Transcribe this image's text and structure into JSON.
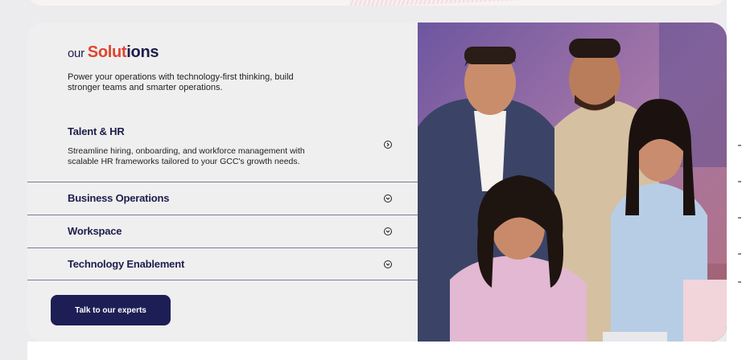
{
  "solutions": {
    "heading_prefix": "our",
    "heading_accent": "Solut",
    "heading_rest": "ions",
    "intro": "Power your operations with technology-first thinking, build stronger teams and smarter operations.",
    "items": [
      {
        "title": "Talent & HR",
        "description": "Streamline hiring, onboarding, and workforce management with scalable HR frameworks tailored to your GCC's growth needs.",
        "expanded": true,
        "icon": "chevron-right-circle-icon"
      },
      {
        "title": "Business Operations",
        "expanded": false,
        "icon": "chevron-down-circle-icon"
      },
      {
        "title": "Workspace",
        "expanded": false,
        "icon": "chevron-down-circle-icon"
      },
      {
        "title": "Technology Enablement",
        "expanded": false,
        "icon": "chevron-down-circle-icon"
      }
    ],
    "cta_label": "Talk to our experts"
  },
  "colors": {
    "accent": "#e0452f",
    "navy": "#1e1d4d",
    "button": "#1e1e56",
    "card_bg": "#efefef"
  }
}
